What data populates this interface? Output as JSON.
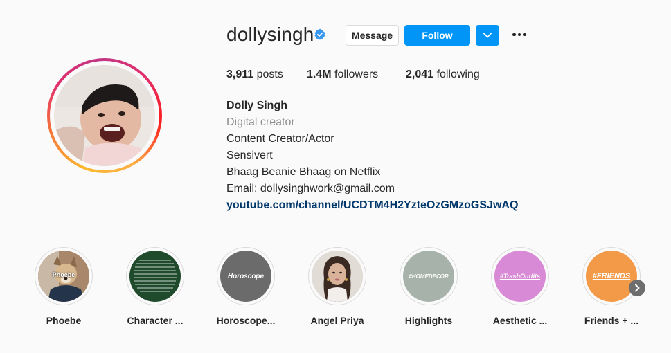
{
  "profile": {
    "username": "dollysingh",
    "verified_icon": "verified-badge-icon",
    "message_label": "Message",
    "follow_label": "Follow",
    "dropdown_icon": "chevron-down-icon",
    "more_icon": "more-options-icon"
  },
  "stats": {
    "posts_count": "3,911",
    "posts_label": "posts",
    "followers_count": "1.4M",
    "followers_label": "followers",
    "following_count": "2,041",
    "following_label": "following"
  },
  "bio": {
    "name": "Dolly Singh",
    "category": "Digital creator",
    "lines": [
      "Content Creator/Actor",
      "Sensivert",
      "Bhaag Beanie Bhaag on Netflix",
      "Email: dollysinghwork@gmail.com"
    ],
    "link": "youtube.com/channel/UCDTM4H2YzteOzGMzoGSJwAQ"
  },
  "highlights": [
    {
      "label": "Phoebe",
      "cover_text": "Phoebe"
    },
    {
      "label": "Character ...",
      "cover_text": ""
    },
    {
      "label": "Horoscope...",
      "cover_text": "Horoscope"
    },
    {
      "label": "Angel Priya",
      "cover_text": ""
    },
    {
      "label": "Highlights",
      "cover_text": "#HOMEDECOR"
    },
    {
      "label": "Aesthetic ...",
      "cover_text": "#TrashOutfits"
    },
    {
      "label": "Friends + ...",
      "cover_text": "#FRIENDS"
    }
  ],
  "colors": {
    "accent_blue": "#0095f6",
    "link_blue": "#00376b",
    "verified_blue": "#3897f0",
    "highlight_character_bg": "#1f4a2c",
    "highlight_horoscope_bg": "#6b6b6b",
    "highlight_homedecor_bg": "#a7b3aa",
    "highlight_trash_bg": "#d88ad6",
    "highlight_friends_bg": "#f39a48"
  }
}
